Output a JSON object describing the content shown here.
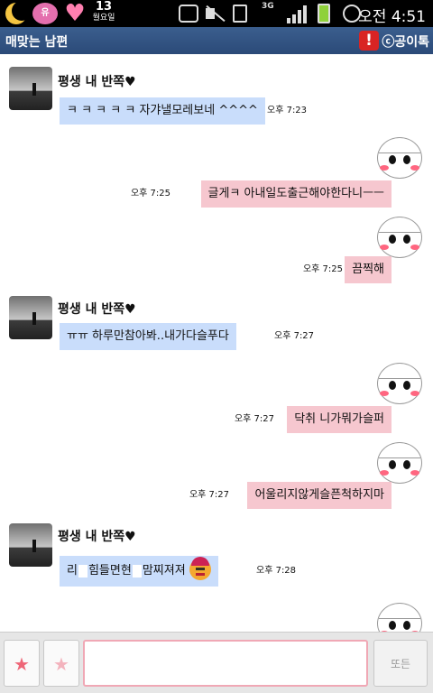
{
  "status_bar": {
    "ball_label": "유",
    "date_number": "13",
    "weekday": "월요일",
    "network": "3G",
    "time": "오전 4:51"
  },
  "titlebar": {
    "title": "매맞는 남편",
    "alert_symbol": "!",
    "brand": "ⓒ공이톡"
  },
  "sender_name": "평생 내 반쪽♥",
  "messages": [
    {
      "side": "in",
      "text": "ㅋ ㅋ ㅋ ㅋ ㅋ  자갸낼모레보네 ^^^^",
      "time": "오후 7:23"
    },
    {
      "side": "out",
      "text": "글게ㅋ 아내일도출근해야한다니ㅡㅡ",
      "time": "오후 7:25"
    },
    {
      "side": "out",
      "text": "끔찍해",
      "time": "오후 7:25"
    },
    {
      "side": "in",
      "text": "ㅠㅠ 하루만참아봐..내가다슬푸다",
      "time": "오후 7:27"
    },
    {
      "side": "out",
      "text": "닥취 니가뭐가슬퍼",
      "time": "오후 7:27"
    },
    {
      "side": "out",
      "text": "어울리지않게슬픈척하지마",
      "time": "오후 7:27"
    },
    {
      "side": "in",
      "text_a": "리",
      "text_b": "힘들면현",
      "text_c": "맘찌져져",
      "time": "오후 7:28"
    }
  ],
  "input": {
    "star_a": "★",
    "star_b": "★",
    "placeholder": "",
    "send_label": "또든"
  },
  "colors": {
    "titlebar": "#2b4a78",
    "incoming_bubble": "#c9ddfb",
    "outgoing_bubble": "#f6c7cf",
    "input_border": "#f0a8b5"
  },
  "icons": [
    "moon-icon",
    "heart-icon",
    "screen-icon",
    "mute-icon",
    "vibrate-icon",
    "signal-icon",
    "battery-icon",
    "alarm-icon",
    "alert-icon",
    "star-icon",
    "emoticon-icon"
  ]
}
